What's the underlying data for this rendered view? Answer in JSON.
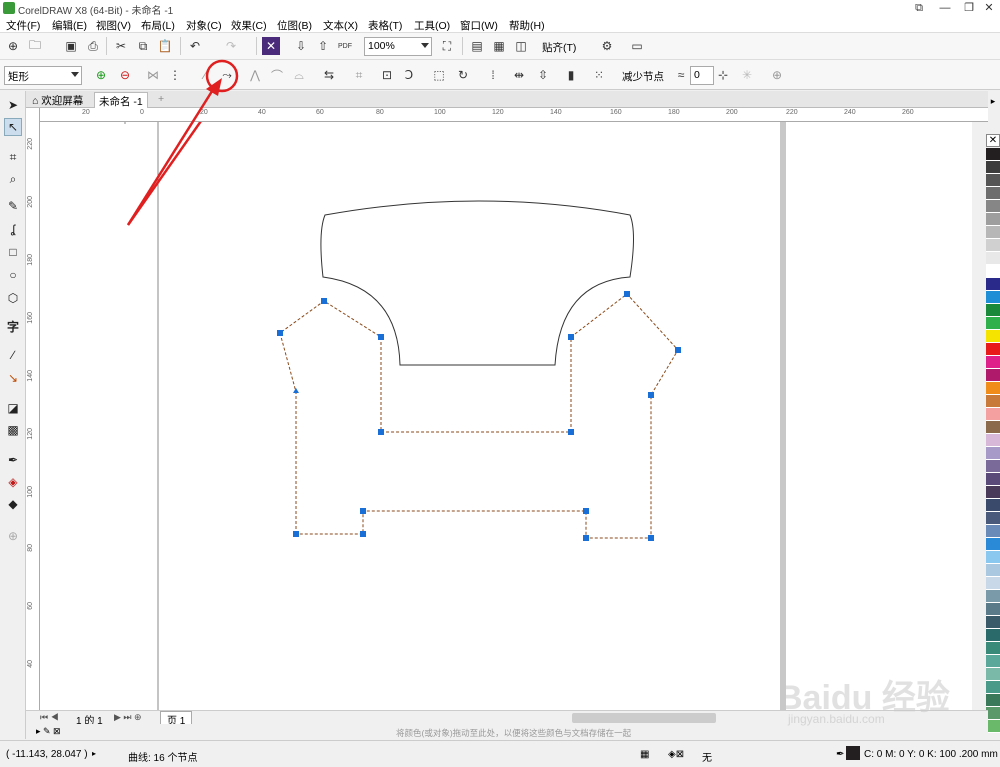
{
  "window": {
    "title": "CorelDRAW X8 (64-Bit) - 未命名 -1"
  },
  "menu": [
    "文件(F)",
    "编辑(E)",
    "视图(V)",
    "布局(L)",
    "对象(C)",
    "效果(C)",
    "位图(B)",
    "文本(X)",
    "表格(T)",
    "工具(O)",
    "窗口(W)",
    "帮助(H)"
  ],
  "standard_toolbar": {
    "zoom": "100%",
    "snap_label": "贴齐(T)",
    "pdf_label": "PDF"
  },
  "property_bar": {
    "shape_select": "矩形",
    "reduce_nodes_label": "减少节点",
    "smoothness_value": "0"
  },
  "doc_tabs": {
    "welcome": "欢迎屏幕",
    "document": "未命名 -1"
  },
  "rulers": {
    "h_labels": [
      "40",
      "20",
      "0",
      "20",
      "40",
      "60",
      "80",
      "100",
      "120",
      "140",
      "160",
      "180",
      "200",
      "220",
      "240",
      "260"
    ],
    "v_labels": [
      "220",
      "200",
      "180",
      "160",
      "140",
      "120",
      "100",
      "80",
      "60",
      "40"
    ]
  },
  "page_nav": {
    "page_counter": "1 的 1",
    "page_tab": "页 1"
  },
  "color_hint": "将颜色(或对象)拖动至此处，以便将这些颜色与文档存储在一起",
  "status": {
    "coords": "( -11.143, 28.047 )",
    "object_info": "曲线: 16 个节点",
    "fill_none": "无",
    "outline_info": "C: 0 M: 0 Y: 0 K: 100  .200 mm"
  },
  "watermark": {
    "text": "Baidu 经验",
    "subtext": "jingyan.baidu.com"
  },
  "colors": {
    "selection_node": "#1a6fd6",
    "annotation": "#e02020",
    "palette": [
      "#231f20",
      "#3c3c3c",
      "#555",
      "#6d6d6d",
      "#868686",
      "#9e9e9e",
      "#b7b7b7",
      "#d0d0d0",
      "#e8e8e8",
      "#ffffff",
      "#2a2a8a",
      "#1e8fd6",
      "#1a8a3a",
      "#2fb04a",
      "#f5e400",
      "#e81a1a",
      "#e0208a",
      "#b01a6a",
      "#f08c1a",
      "#c87a3a",
      "#f4a0a0",
      "#8a6a4a",
      "#d8b8d8",
      "#a89ac8",
      "#7a6a9a",
      "#5a4a7a",
      "#4a3a5a",
      "#3a4a6a",
      "#4a5a7a",
      "#6a8ab8",
      "#2a8ad8",
      "#8ac8f0",
      "#aac8e0",
      "#c8d8e8",
      "#7a9aaa",
      "#5a7a8a",
      "#3a5a6a",
      "#2a6a6a",
      "#3a8a7a",
      "#5aa89a",
      "#7ab8a8",
      "#4a9a8a",
      "#3a7a5a",
      "#5a9a6a",
      "#6ab86a"
    ]
  }
}
